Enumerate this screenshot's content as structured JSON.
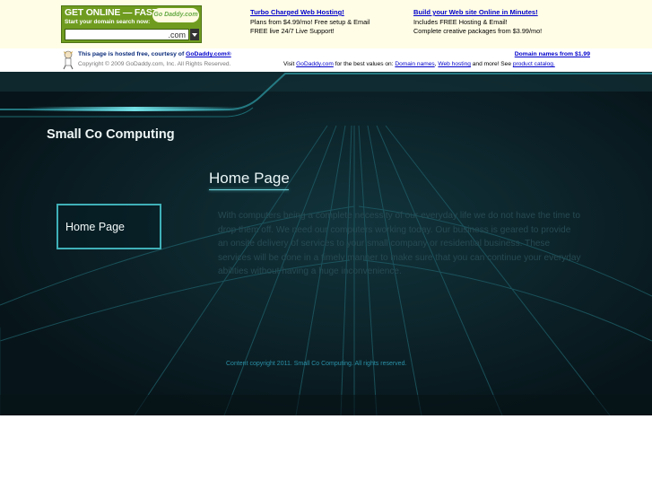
{
  "ad": {
    "godaddy_box": {
      "headline": "GET ONLINE — FAST!",
      "subline": "Start your domain search now:",
      "logo": "Go Daddy.com",
      "input_value": "",
      "tld": ".com"
    },
    "promo1": {
      "title": "Turbo Charged Web Hosting!",
      "line1": "Plans from $4.99/mo! Free setup & Email",
      "line2": "FREE live 24/7 Live Support!"
    },
    "promo2": {
      "title": "Build your Web site Online in Minutes!",
      "line1": "Includes FREE Hosting & Email!",
      "line2": "Complete creative packages from $3.99/mo!"
    },
    "hosted_prefix": "This page is hosted free, courtesy of ",
    "hosted_link": "GoDaddy.com®",
    "copyright": "Copyright © 2009 GoDaddy.com, Inc. All Rights Reserved.",
    "domain_names_link": "Domain names from $1.99",
    "visit_prefix": "Visit ",
    "visit_link": "GoDaddy.com",
    "visit_middle": " for the best values on: ",
    "link_domain_names": "Domain names",
    "comma": ", ",
    "link_web_hosting": "Web hosting",
    "visit_more": " and more! See ",
    "link_catalog": "product catalog.",
    "icons": [
      "godaddy-guy-icon",
      "dropdown-arrow-icon"
    ]
  },
  "site": {
    "brand": "Small Co Computing",
    "page_title": "Home Page",
    "nav": [
      {
        "label": "Home Page"
      }
    ],
    "body": "With computers being a complete necessity of our everyday life we do not have the time to drop them off. We need our computers working today.  Our business is geared to provide an onsite delivery of services to your small company or residential business.  These services will be done in a timely manner to make sure that you can continue your everyday abilities without having a huge inconvenience.",
    "footer": "Content copyright 2011. Small Co Computing. All rights reserved.",
    "colors": {
      "background": "#0a1c22",
      "accent": "#3fb0b8",
      "text_dim": "#274a52",
      "footer": "#2a8fa6"
    }
  }
}
